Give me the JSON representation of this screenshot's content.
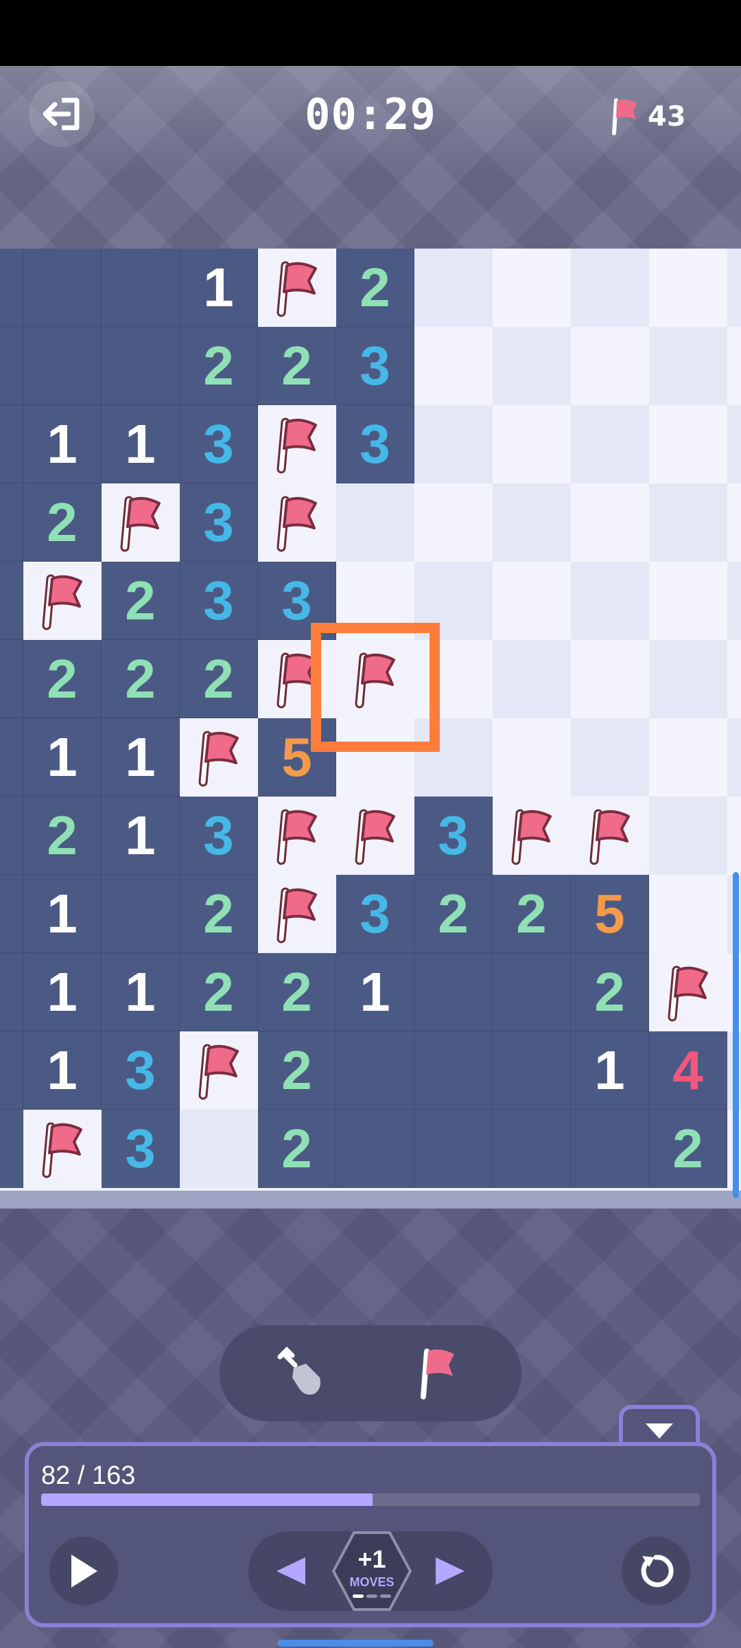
{
  "header": {
    "timer": "00:29",
    "flags_remaining": "43"
  },
  "progress": {
    "text": "82 / 163",
    "value": 82,
    "total": 163
  },
  "moves": {
    "count": "+1",
    "label": "MOVES"
  },
  "colors": {
    "accent": "#8b80d6",
    "cursor": "#ff7d3a",
    "revealed_cell": "#4b5a84",
    "flag": "#f06a8a"
  },
  "board": {
    "cols": 10,
    "rows": 12,
    "cursor": {
      "row": 5,
      "col": 4
    },
    "cells": [
      [
        " ",
        " ",
        "1",
        "F",
        "2",
        "H",
        "H",
        "H",
        "H",
        "H"
      ],
      [
        " ",
        " ",
        "2",
        "2",
        "3",
        "H",
        "H",
        "H",
        "H",
        "H"
      ],
      [
        "1",
        "1",
        "3",
        "F",
        "3",
        "H",
        "H",
        "H",
        "H",
        "H"
      ],
      [
        "2",
        "F",
        "3",
        "F",
        "H",
        "H",
        "H",
        "H",
        "H",
        "H"
      ],
      [
        "F",
        "2",
        "3",
        "3",
        "H",
        "H",
        "H",
        "H",
        "H",
        "H"
      ],
      [
        "2",
        "2",
        "2",
        "F",
        "F",
        "H",
        "H",
        "H",
        "H",
        "H"
      ],
      [
        "1",
        "1",
        "F",
        "5",
        "H",
        "H",
        "H",
        "H",
        "H",
        "H"
      ],
      [
        "2",
        "1",
        "3",
        "F",
        "F",
        "3",
        "F",
        "F",
        "H",
        "H"
      ],
      [
        "1",
        " ",
        "2",
        "F",
        "3",
        "2",
        "2",
        "5",
        "H",
        "H"
      ],
      [
        "1",
        "1",
        "2",
        "2",
        "1",
        " ",
        " ",
        "2",
        "F",
        "H"
      ],
      [
        "1",
        "3",
        "F",
        "2",
        " ",
        " ",
        " ",
        "1",
        "4",
        "H"
      ],
      [
        "F",
        "3",
        "H",
        "2",
        " ",
        " ",
        " ",
        " ",
        "2",
        "H"
      ]
    ]
  }
}
